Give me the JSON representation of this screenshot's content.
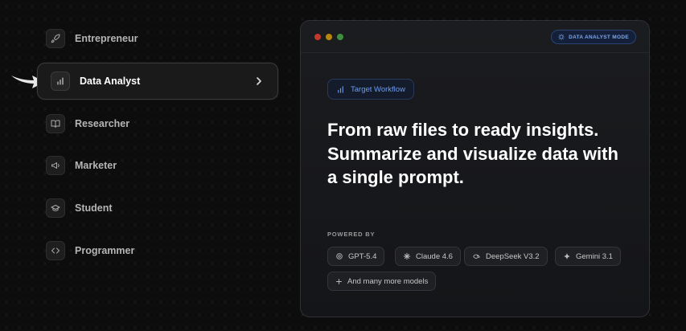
{
  "personas": [
    {
      "label": "Entrepreneur",
      "icon": "rocket-icon",
      "active": false
    },
    {
      "label": "Data Analyst",
      "icon": "bar-chart-icon",
      "active": true
    },
    {
      "label": "Researcher",
      "icon": "book-open-icon",
      "active": false
    },
    {
      "label": "Marketer",
      "icon": "megaphone-icon",
      "active": false
    },
    {
      "label": "Student",
      "icon": "graduation-cap-icon",
      "active": false
    },
    {
      "label": "Programmer",
      "icon": "code-icon",
      "active": false
    }
  ],
  "window": {
    "mode_badge": "DATA ANALYST MODE",
    "workflow_label": "Target Workflow",
    "headline": "From raw files to ready insights. Summarize and visualize data with a single prompt.",
    "powered_by": "POWERED BY",
    "models": [
      {
        "label": "GPT-5.4",
        "icon": "openai-icon"
      },
      {
        "label": "Claude 4.6",
        "icon": "claude-icon"
      },
      {
        "label": "DeepSeek V3.2",
        "icon": "deepseek-icon"
      },
      {
        "label": "Gemini 3.1",
        "icon": "gemini-icon"
      },
      {
        "label": "And many more models",
        "icon": "plus-icon"
      }
    ]
  },
  "colors": {
    "accent_blue": "#6f9bea",
    "background": "#0d0d0d",
    "traffic_red": "#c0392b",
    "traffic_yellow": "#b8860b",
    "traffic_green": "#3e8e41"
  }
}
